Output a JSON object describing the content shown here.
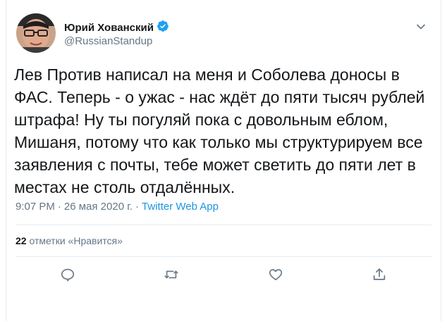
{
  "author": {
    "display_name": "Юрий Хованский",
    "handle": "@RussianStandup",
    "verified": true
  },
  "tweet": {
    "text": "Лев Против написал на меня и Соболева доносы в ФАС. Теперь - о ужас - нас ждёт до пяти тысяч рублей штрафа! Ну ты погуляй пока с довольным еблом, Мишаня, потому что как только мы структурируем все заявления с почты, тебе может светить до пяти лет в местах не столь отдалённых.",
    "time": "9:07 PM",
    "separator": "·",
    "date": "26 мая 2020 г.",
    "source": "Twitter Web App"
  },
  "stats": {
    "likes_count": "22",
    "likes_label": "отметки «Нравится»"
  },
  "icons": {
    "caret": "chevron-down-icon",
    "verified": "verified-badge-icon",
    "reply": "reply-icon",
    "retweet": "retweet-icon",
    "like": "heart-icon",
    "share": "share-icon"
  },
  "colors": {
    "accent": "#1b95e0",
    "verified": "#1da1f2",
    "muted": "#657786",
    "text": "#14171a",
    "border": "#e6ecf0"
  }
}
